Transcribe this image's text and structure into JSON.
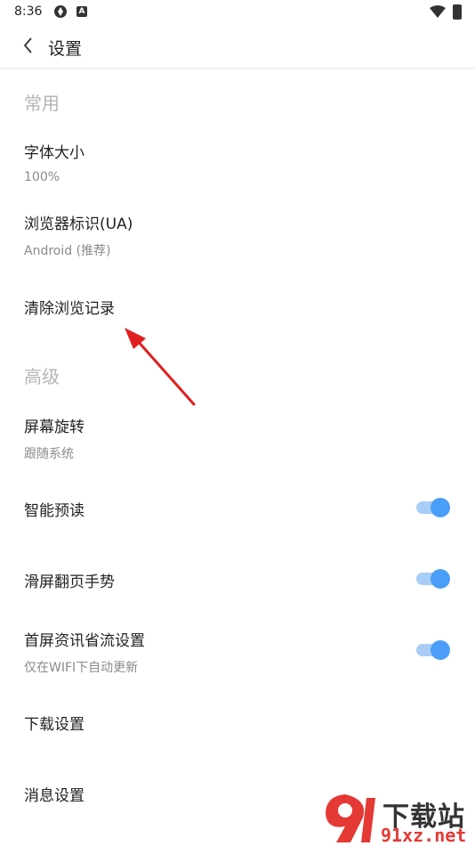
{
  "status_bar": {
    "time": "8:36",
    "icon_b_letter": "A"
  },
  "header": {
    "title": "设置"
  },
  "sections": {
    "common": "常用",
    "advanced": "高级"
  },
  "items": {
    "font_size": {
      "title": "字体大小",
      "value": "100%"
    },
    "ua": {
      "title": "浏览器标识(UA)",
      "value": "Android (推荐)"
    },
    "clear_history": {
      "title": "清除浏览记录"
    },
    "rotation": {
      "title": "屏幕旋转",
      "value": "跟随系统"
    },
    "smart_preread": {
      "title": "智能预读",
      "enabled": true
    },
    "swipe_gesture": {
      "title": "滑屏翻页手势",
      "enabled": true
    },
    "data_saver": {
      "title": "首屏资讯省流设置",
      "subtitle": "仅在WIFI下自动更新",
      "enabled": true
    },
    "download": {
      "title": "下载设置"
    },
    "message": {
      "title": "消息设置"
    }
  },
  "colors": {
    "accent": "#4a9df8",
    "accent_light": "#a9cdf6",
    "annotation_arrow": "#e02020"
  },
  "watermark": {
    "text": "下载站",
    "url": "91xz.net"
  }
}
